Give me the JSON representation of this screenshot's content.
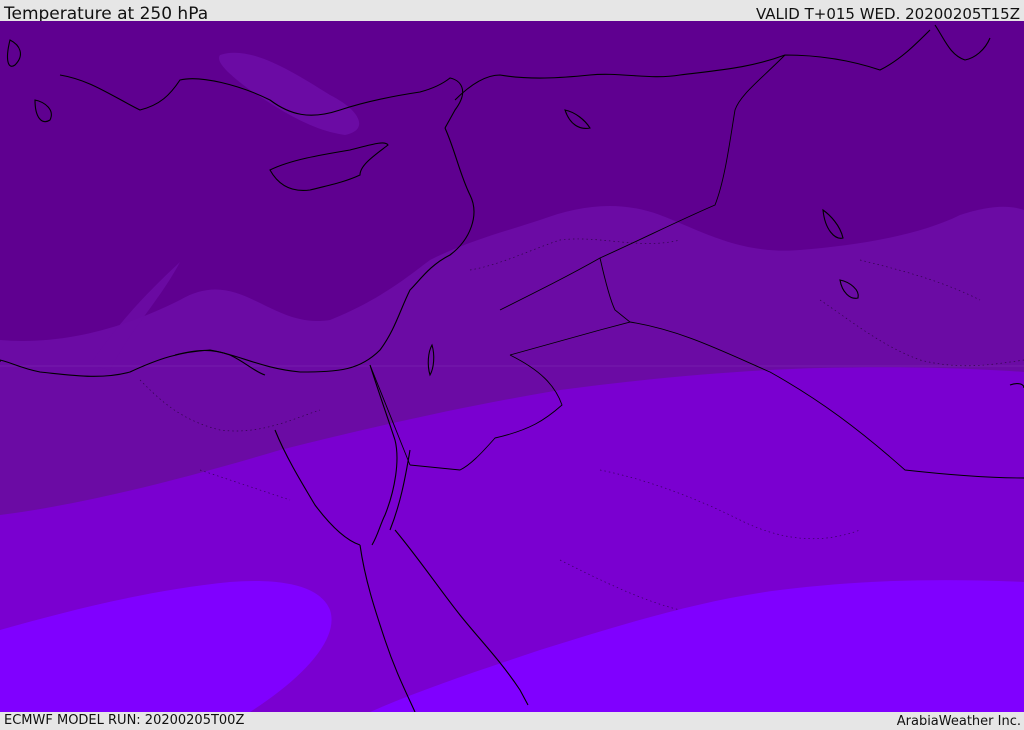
{
  "header": {
    "title": "Temperature at 250 hPa",
    "valid": "VALID T+015 WED. 20200205T15Z"
  },
  "footer": {
    "model_run": "ECMWF MODEL RUN: 20200205T00Z",
    "credit": "ArabiaWeather Inc."
  },
  "colors": {
    "band_coldest": "#5f0090",
    "band_cold": "#6b0ba4",
    "band_mid": "#7a00d0",
    "band_warm": "#8000ff",
    "coastline": "#000000",
    "header_bg": "#e6e6e6"
  }
}
